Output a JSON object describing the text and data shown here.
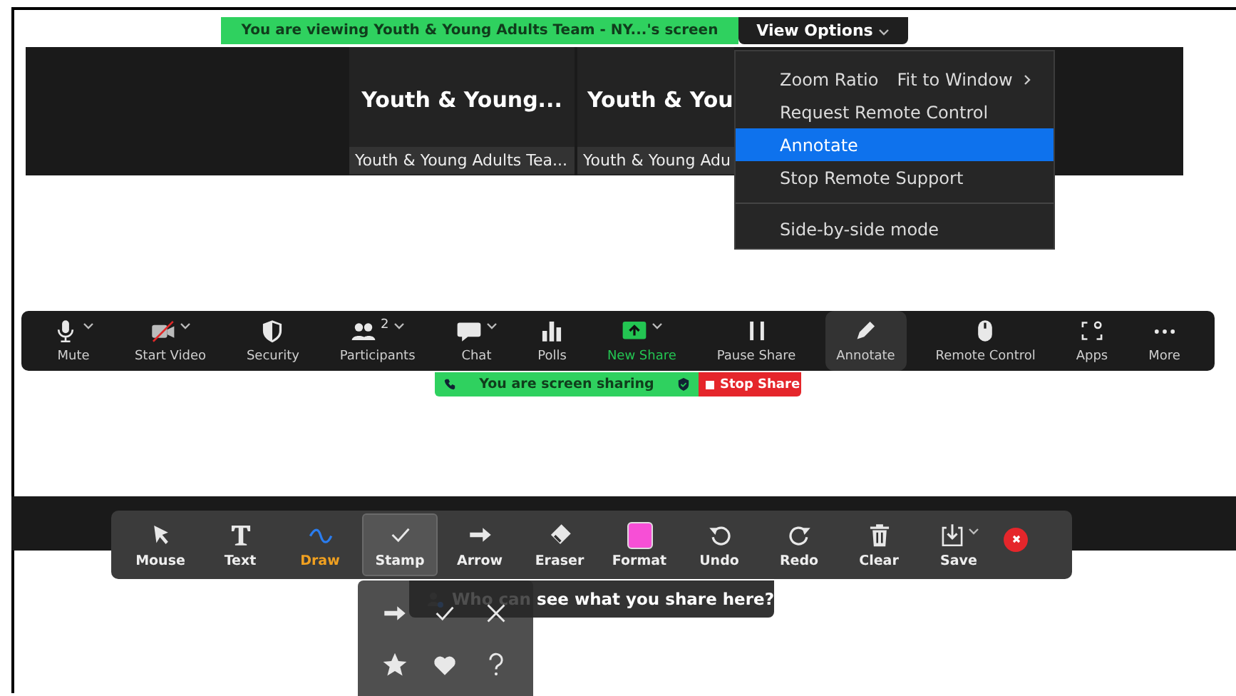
{
  "viewing_banner": {
    "text": "You are viewing Youth & Young Adults Team - NY...'s screen"
  },
  "view_options": {
    "label": "View Options",
    "expanded": true
  },
  "video_tiles": [
    {
      "title": "Youth & Young...",
      "name": "Youth & Young Adults Tea..."
    },
    {
      "title": "Youth & You",
      "name": "Youth & Young Adu"
    }
  ],
  "view_menu": {
    "items": [
      {
        "kind": "submenu",
        "label": "Zoom Ratio",
        "value": "Fit to Window",
        "selected": false
      },
      {
        "kind": "item",
        "label": "Request Remote Control",
        "selected": false
      },
      {
        "kind": "item",
        "label": "Annotate",
        "selected": true
      },
      {
        "kind": "item",
        "label": "Stop Remote Support",
        "selected": false
      },
      {
        "kind": "separator"
      },
      {
        "kind": "item",
        "label": "Side-by-side mode",
        "selected": false
      }
    ]
  },
  "meeting_toolbar": {
    "buttons": [
      {
        "label": "Mute",
        "caret": true,
        "selected": false,
        "green": false
      },
      {
        "label": "Start Video",
        "caret": true,
        "selected": false,
        "green": false
      },
      {
        "label": "Security",
        "caret": false,
        "selected": false,
        "green": false
      },
      {
        "label": "Participants",
        "badge": "2",
        "caret": true,
        "selected": false,
        "green": false
      },
      {
        "label": "Chat",
        "caret": true,
        "selected": false,
        "green": false
      },
      {
        "label": "Polls",
        "caret": false,
        "selected": false,
        "green": false
      },
      {
        "label": "New Share",
        "caret": true,
        "selected": false,
        "green": true
      },
      {
        "label": "Pause Share",
        "caret": false,
        "selected": false,
        "green": false
      },
      {
        "label": "Annotate",
        "caret": false,
        "selected": true,
        "green": false
      },
      {
        "label": "Remote Control",
        "caret": false,
        "selected": false,
        "green": false
      },
      {
        "label": "Apps",
        "caret": false,
        "selected": false,
        "green": false
      },
      {
        "label": "More",
        "caret": false,
        "selected": false,
        "green": false
      }
    ]
  },
  "sharing_bar": {
    "text": "You are screen sharing",
    "stop_label": "Stop Share"
  },
  "annotation_toolbar": {
    "tools": [
      {
        "label": "Mouse",
        "selected": false,
        "active": false,
        "caret": false
      },
      {
        "label": "Text",
        "selected": false,
        "active": false,
        "caret": false
      },
      {
        "label": "Draw",
        "selected": false,
        "active": true,
        "caret": false
      },
      {
        "label": "Stamp",
        "selected": true,
        "active": false,
        "caret": false
      },
      {
        "label": "Arrow",
        "selected": false,
        "active": false,
        "caret": false
      },
      {
        "label": "Eraser",
        "selected": false,
        "active": false,
        "caret": false
      },
      {
        "label": "Format",
        "color": "#f74fd6",
        "selected": false,
        "active": false,
        "caret": false
      },
      {
        "label": "Undo",
        "selected": false,
        "active": false,
        "caret": false
      },
      {
        "label": "Redo",
        "selected": false,
        "active": false,
        "caret": false
      },
      {
        "label": "Clear",
        "selected": false,
        "active": false,
        "caret": false
      },
      {
        "label": "Save",
        "selected": false,
        "active": false,
        "caret": true
      }
    ]
  },
  "stamp_menu": {
    "stamps": [
      {
        "kind": "arrow"
      },
      {
        "kind": "check"
      },
      {
        "kind": "cross"
      },
      {
        "kind": "star"
      },
      {
        "kind": "heart"
      },
      {
        "kind": "question"
      }
    ]
  },
  "tooltip": {
    "text": "Who can see what you share here?"
  }
}
